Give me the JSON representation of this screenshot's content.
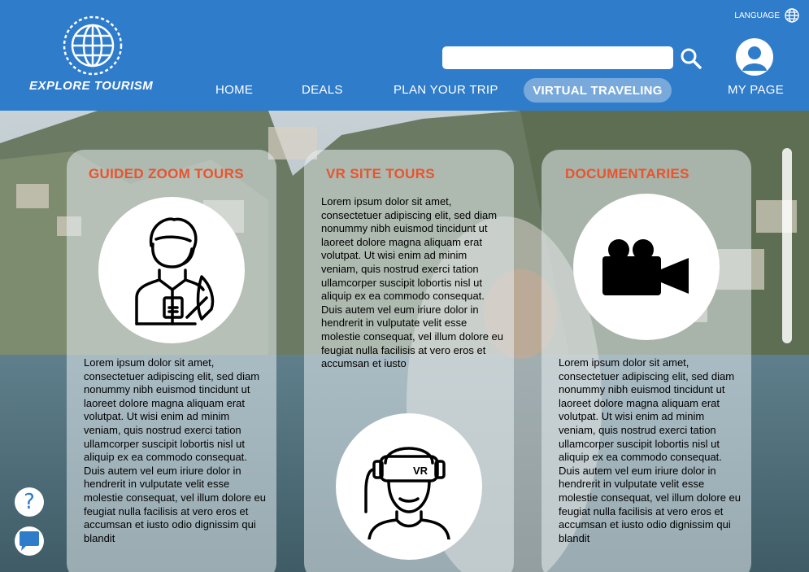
{
  "brand": {
    "name": "EXPLORE TOURISM",
    "icon": "globe-icon"
  },
  "header": {
    "language_label": "LANGUAGE",
    "search": {
      "value": "",
      "placeholder": ""
    },
    "nav": [
      "HOME",
      "DEALS",
      "PLAN YOUR TRIP",
      "VIRTUAL TRAVELING",
      "MY PAGE"
    ],
    "active_nav": "VIRTUAL TRAVELING"
  },
  "cards": [
    {
      "title": "GUIDED ZOOM TOURS",
      "icon": "tour-guide-icon",
      "text": "Lorem ipsum dolor sit amet, consectetuer adipiscing elit, sed diam nonummy nibh euismod tincidunt ut laoreet dolore magna aliquam erat volutpat. Ut wisi enim ad minim veniam, quis nostrud exerci tation ullamcorper suscipit lobortis nisl ut aliquip ex ea commodo consequat. Duis autem vel eum iriure dolor in hendrerit in vulputate velit esse molestie consequat, vel illum dolore eu feugiat nulla facilisis at vero eros et accumsan et iusto odio dignissim qui blandit"
    },
    {
      "title": "VR SITE TOURS",
      "icon": "vr-headset-icon",
      "icon_label": "VR",
      "text": "Lorem ipsum dolor sit amet, consectetuer adipiscing elit, sed diam nonummy nibh euismod tincidunt ut laoreet dolore magna aliquam erat volutpat. Ut wisi enim ad minim veniam, quis nostrud exerci tation ullamcorper suscipit lobortis nisl ut aliquip ex ea commodo consequat. Duis autem vel eum iriure dolor in hendrerit in vulputate velit esse molestie consequat, vel illum dolore eu feugiat nulla facilisis at vero eros et accumsan et iusto"
    },
    {
      "title": "DOCUMENTARIES",
      "icon": "video-camera-icon",
      "text": "Lorem ipsum dolor sit amet, consectetuer adipiscing elit, sed diam nonummy nibh euismod tincidunt ut laoreet dolore magna aliquam erat volutpat. Ut wisi enim ad minim veniam, quis nostrud exerci tation ullamcorper suscipit lobortis nisl ut aliquip ex ea commodo consequat. Duis autem vel eum iriure dolor in hendrerit in vulputate velit esse molestie consequat, vel illum dolore eu feugiat nulla facilisis at vero eros et accumsan et iusto odio dignissim qui blandit"
    }
  ],
  "help": {
    "label": "?",
    "icon": "help-icon"
  },
  "chat": {
    "icon": "chat-icon"
  },
  "colors": {
    "header": "#2f7ccb",
    "accent": "#e8542e",
    "active_pill": "#79a9db"
  }
}
